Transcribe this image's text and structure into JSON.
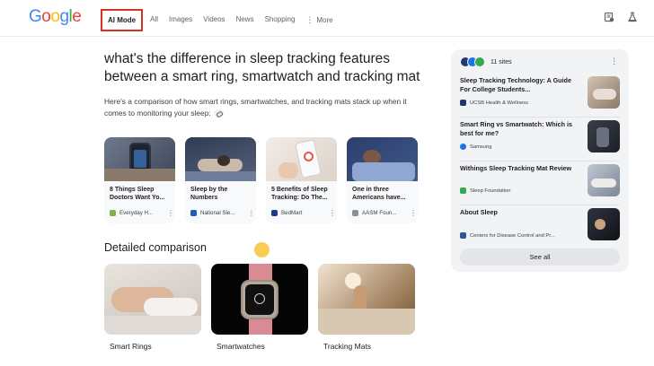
{
  "header": {
    "logo": [
      "G",
      "o",
      "o",
      "g",
      "l",
      "e"
    ],
    "logo_colors": [
      "#4285f4",
      "#ea4335",
      "#fbbc05",
      "#4285f4",
      "#34a853",
      "#ea4335"
    ],
    "tabs": [
      "AI Mode",
      "All",
      "Images",
      "Videos",
      "News",
      "Shopping",
      "More"
    ]
  },
  "query": "what's the difference in sleep tracking features between a smart ring, smartwatch and tracking mat",
  "answer": "Here's a comparison of how smart rings, smartwatches, and tracking mats stack up when it comes to monitoring your sleep:",
  "cards": [
    {
      "title": "8 Things Sleep Doctors Want Yo...",
      "source": "Everyday H..."
    },
    {
      "title": "Sleep by the Numbers",
      "source": "National Sle..."
    },
    {
      "title": "5 Benefits of Sleep Tracking: Do The...",
      "source": "BedMart"
    },
    {
      "title": "One in three Americans have...",
      "source": "AASM Foun..."
    }
  ],
  "detailed": {
    "heading": "Detailed comparison",
    "items": [
      "Smart Rings",
      "Smartwatches",
      "Tracking Mats"
    ]
  },
  "panel": {
    "count": "11 sites",
    "items": [
      {
        "title": "Sleep Tracking Technology: A Guide For College Students...",
        "source": "UCSB Health & Wellness"
      },
      {
        "title": "Smart Ring vs Smartwatch: Which is best for me?",
        "source": "Samsung"
      },
      {
        "title": "Withings Sleep Tracking Mat Review",
        "source": "Sleep Foundation"
      },
      {
        "title": "About Sleep",
        "source": "Centers for Disease Control and Pr..."
      }
    ],
    "see_all": "See all"
  },
  "colors": {
    "highlight": "#d93025",
    "dot": "#f6c842"
  },
  "icons": [
    "labs-icon",
    "flask-icon",
    "kebab-icon",
    "link-icon"
  ]
}
